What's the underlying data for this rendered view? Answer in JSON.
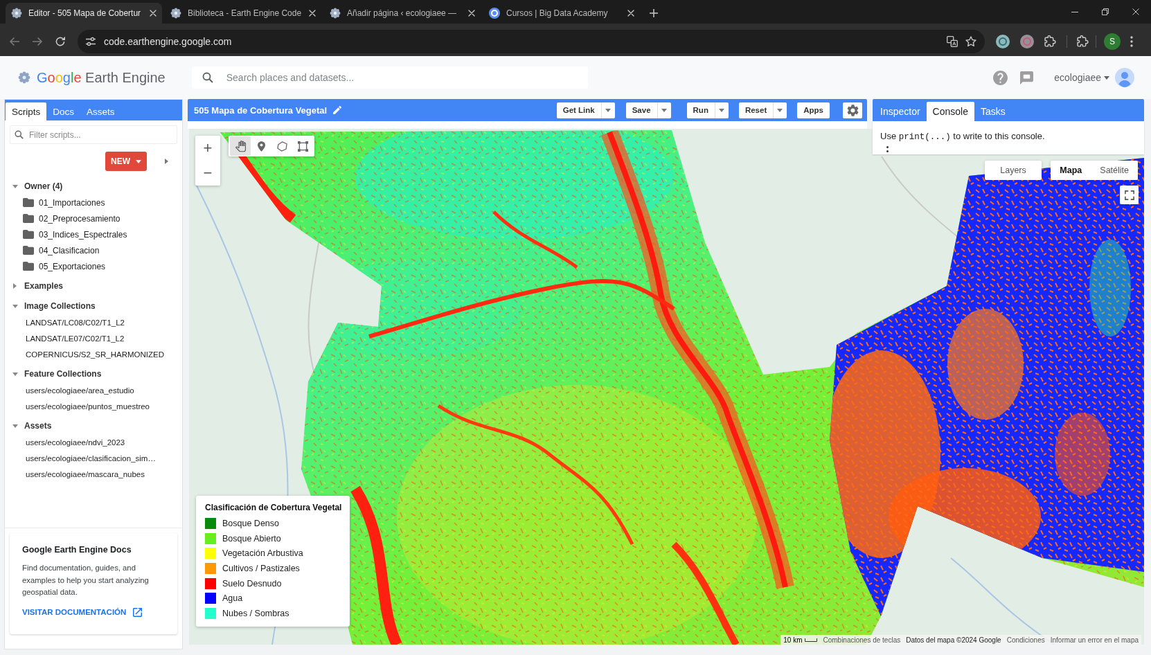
{
  "browser": {
    "tabs": [
      {
        "title": "Editor - 505 Mapa de Cobertur",
        "selected": true
      },
      {
        "title": "Biblioteca - Earth Engine Code",
        "selected": false
      },
      {
        "title": "Añadir página ‹ ecologiaee —",
        "selected": false
      },
      {
        "title": "Cursos | Big Data Academy",
        "selected": false
      }
    ],
    "address": "code.earthengine.google.com",
    "profile_initial": "S"
  },
  "header": {
    "logo": {
      "brand": "Google",
      "product": "Earth Engine"
    },
    "search": {
      "placeholder": "Search places and datasets..."
    },
    "user": "ecologiaee"
  },
  "scripts_panel": {
    "tabs": [
      {
        "label": "Scripts",
        "selected": true
      },
      {
        "label": "Docs",
        "selected": false
      },
      {
        "label": "Assets",
        "selected": false
      }
    ],
    "filter": {
      "placeholder": "Filter scripts..."
    },
    "new_button": "NEW",
    "tree": [
      {
        "label": "Owner (4)",
        "expanded": true,
        "children": [
          {
            "label": "01_Importaciones",
            "kind": "folder"
          },
          {
            "label": "02_Preprocesamiento",
            "kind": "folder"
          },
          {
            "label": "03_Indices_Espectrales",
            "kind": "folder"
          },
          {
            "label": "04_Clasificacion",
            "kind": "folder"
          },
          {
            "label": "05_Exportaciones",
            "kind": "folder"
          }
        ]
      },
      {
        "label": "Examples",
        "expanded": false
      },
      {
        "label": "Image Collections",
        "expanded": true,
        "children": [
          {
            "label": "LANDSAT/LC08/C02/T1_L2",
            "kind": "entry"
          },
          {
            "label": "LANDSAT/LE07/C02/T1_L2",
            "kind": "entry"
          },
          {
            "label": "COPERNICUS/S2_SR_HARMONIZED",
            "kind": "entry"
          }
        ]
      },
      {
        "label": "Feature Collections",
        "expanded": true,
        "children": [
          {
            "label": "users/ecologiaee/area_estudio",
            "kind": "entry"
          },
          {
            "label": "users/ecologiaee/puntos_muestreo",
            "kind": "entry"
          }
        ]
      },
      {
        "label": "Assets",
        "expanded": true,
        "children": [
          {
            "label": "users/ecologiaee/ndvi_2023",
            "kind": "entry"
          },
          {
            "label": "users/ecologiaee/clasificacion_sim…",
            "kind": "entry"
          },
          {
            "label": "users/ecologiaee/mascara_nubes",
            "kind": "entry"
          }
        ]
      }
    ],
    "docs_card": {
      "title": "Google Earth Engine Docs",
      "text": "Find documentation, guides, and examples to help you start analyzing geospatial data.",
      "link": "VISITAR DOCUMENTACIÓN"
    }
  },
  "editor": {
    "title": "505 Mapa de Cobertura Vegetal",
    "buttons": [
      {
        "label": "Get Link",
        "dropdown": true
      },
      {
        "label": "Save",
        "dropdown": true
      },
      {
        "label": "Run",
        "dropdown": true
      },
      {
        "label": "Reset",
        "dropdown": true
      },
      {
        "label": "Apps",
        "dropdown": false
      }
    ]
  },
  "right_panel": {
    "tabs": [
      {
        "label": "Inspector",
        "selected": false
      },
      {
        "label": "Console",
        "selected": true
      },
      {
        "label": "Tasks",
        "selected": false
      }
    ],
    "console": {
      "before": "Use",
      "code": "print(...)",
      "after": "to write to this console."
    }
  },
  "map": {
    "zoom_buttons": [
      "+",
      "−"
    ],
    "drawing_tools": [
      {
        "kind": "hand",
        "selected": true
      },
      {
        "kind": "point",
        "selected": false
      },
      {
        "kind": "shape",
        "selected": false
      },
      {
        "kind": "rectangle",
        "selected": false
      }
    ],
    "layers_button": "Layers",
    "map_types": [
      {
        "label": "Mapa",
        "selected": true
      },
      {
        "label": "Satélite",
        "selected": false
      }
    ],
    "legend": {
      "title": "Clasificación de Cobertura Vegetal",
      "items": [
        {
          "label": "Bosque Denso",
          "color": "#0a8a0a"
        },
        {
          "label": "Bosque Abierto",
          "color": "#66ee22"
        },
        {
          "label": "Vegetación Arbustiva",
          "color": "#ffff00"
        },
        {
          "label": "Cultivos / Pastizales",
          "color": "#ff9900"
        },
        {
          "label": "Suelo Desnudo",
          "color": "#ff0000"
        },
        {
          "label": "Agua",
          "color": "#0000ff"
        },
        {
          "label": "Nubes / Sombras",
          "color": "#22ffcc"
        }
      ]
    },
    "attribution": {
      "scale": "10 km",
      "items": [
        {
          "text": "Combinaciones de teclas",
          "kind": "link"
        },
        {
          "text": "Datos del mapa ©2024 Google",
          "kind": "data"
        },
        {
          "text": "Condiciones",
          "kind": "link"
        },
        {
          "text": "Informar un error en el mapa",
          "kind": "link"
        }
      ]
    }
  }
}
